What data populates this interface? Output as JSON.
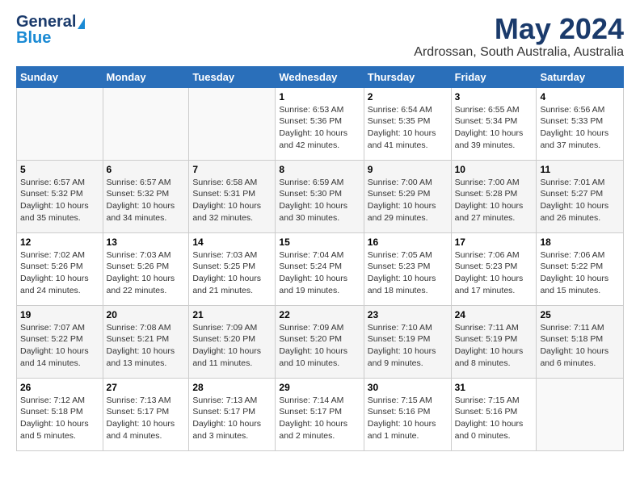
{
  "header": {
    "logo_general": "General",
    "logo_blue": "Blue",
    "month_year": "May 2024",
    "location": "Ardrossan, South Australia, Australia"
  },
  "days_of_week": [
    "Sunday",
    "Monday",
    "Tuesday",
    "Wednesday",
    "Thursday",
    "Friday",
    "Saturday"
  ],
  "weeks": [
    [
      {
        "day": "",
        "sunrise": "",
        "sunset": "",
        "daylight": ""
      },
      {
        "day": "",
        "sunrise": "",
        "sunset": "",
        "daylight": ""
      },
      {
        "day": "",
        "sunrise": "",
        "sunset": "",
        "daylight": ""
      },
      {
        "day": "1",
        "sunrise": "Sunrise: 6:53 AM",
        "sunset": "Sunset: 5:36 PM",
        "daylight": "Daylight: 10 hours and 42 minutes."
      },
      {
        "day": "2",
        "sunrise": "Sunrise: 6:54 AM",
        "sunset": "Sunset: 5:35 PM",
        "daylight": "Daylight: 10 hours and 41 minutes."
      },
      {
        "day": "3",
        "sunrise": "Sunrise: 6:55 AM",
        "sunset": "Sunset: 5:34 PM",
        "daylight": "Daylight: 10 hours and 39 minutes."
      },
      {
        "day": "4",
        "sunrise": "Sunrise: 6:56 AM",
        "sunset": "Sunset: 5:33 PM",
        "daylight": "Daylight: 10 hours and 37 minutes."
      }
    ],
    [
      {
        "day": "5",
        "sunrise": "Sunrise: 6:57 AM",
        "sunset": "Sunset: 5:32 PM",
        "daylight": "Daylight: 10 hours and 35 minutes."
      },
      {
        "day": "6",
        "sunrise": "Sunrise: 6:57 AM",
        "sunset": "Sunset: 5:32 PM",
        "daylight": "Daylight: 10 hours and 34 minutes."
      },
      {
        "day": "7",
        "sunrise": "Sunrise: 6:58 AM",
        "sunset": "Sunset: 5:31 PM",
        "daylight": "Daylight: 10 hours and 32 minutes."
      },
      {
        "day": "8",
        "sunrise": "Sunrise: 6:59 AM",
        "sunset": "Sunset: 5:30 PM",
        "daylight": "Daylight: 10 hours and 30 minutes."
      },
      {
        "day": "9",
        "sunrise": "Sunrise: 7:00 AM",
        "sunset": "Sunset: 5:29 PM",
        "daylight": "Daylight: 10 hours and 29 minutes."
      },
      {
        "day": "10",
        "sunrise": "Sunrise: 7:00 AM",
        "sunset": "Sunset: 5:28 PM",
        "daylight": "Daylight: 10 hours and 27 minutes."
      },
      {
        "day": "11",
        "sunrise": "Sunrise: 7:01 AM",
        "sunset": "Sunset: 5:27 PM",
        "daylight": "Daylight: 10 hours and 26 minutes."
      }
    ],
    [
      {
        "day": "12",
        "sunrise": "Sunrise: 7:02 AM",
        "sunset": "Sunset: 5:26 PM",
        "daylight": "Daylight: 10 hours and 24 minutes."
      },
      {
        "day": "13",
        "sunrise": "Sunrise: 7:03 AM",
        "sunset": "Sunset: 5:26 PM",
        "daylight": "Daylight: 10 hours and 22 minutes."
      },
      {
        "day": "14",
        "sunrise": "Sunrise: 7:03 AM",
        "sunset": "Sunset: 5:25 PM",
        "daylight": "Daylight: 10 hours and 21 minutes."
      },
      {
        "day": "15",
        "sunrise": "Sunrise: 7:04 AM",
        "sunset": "Sunset: 5:24 PM",
        "daylight": "Daylight: 10 hours and 19 minutes."
      },
      {
        "day": "16",
        "sunrise": "Sunrise: 7:05 AM",
        "sunset": "Sunset: 5:23 PM",
        "daylight": "Daylight: 10 hours and 18 minutes."
      },
      {
        "day": "17",
        "sunrise": "Sunrise: 7:06 AM",
        "sunset": "Sunset: 5:23 PM",
        "daylight": "Daylight: 10 hours and 17 minutes."
      },
      {
        "day": "18",
        "sunrise": "Sunrise: 7:06 AM",
        "sunset": "Sunset: 5:22 PM",
        "daylight": "Daylight: 10 hours and 15 minutes."
      }
    ],
    [
      {
        "day": "19",
        "sunrise": "Sunrise: 7:07 AM",
        "sunset": "Sunset: 5:22 PM",
        "daylight": "Daylight: 10 hours and 14 minutes."
      },
      {
        "day": "20",
        "sunrise": "Sunrise: 7:08 AM",
        "sunset": "Sunset: 5:21 PM",
        "daylight": "Daylight: 10 hours and 13 minutes."
      },
      {
        "day": "21",
        "sunrise": "Sunrise: 7:09 AM",
        "sunset": "Sunset: 5:20 PM",
        "daylight": "Daylight: 10 hours and 11 minutes."
      },
      {
        "day": "22",
        "sunrise": "Sunrise: 7:09 AM",
        "sunset": "Sunset: 5:20 PM",
        "daylight": "Daylight: 10 hours and 10 minutes."
      },
      {
        "day": "23",
        "sunrise": "Sunrise: 7:10 AM",
        "sunset": "Sunset: 5:19 PM",
        "daylight": "Daylight: 10 hours and 9 minutes."
      },
      {
        "day": "24",
        "sunrise": "Sunrise: 7:11 AM",
        "sunset": "Sunset: 5:19 PM",
        "daylight": "Daylight: 10 hours and 8 minutes."
      },
      {
        "day": "25",
        "sunrise": "Sunrise: 7:11 AM",
        "sunset": "Sunset: 5:18 PM",
        "daylight": "Daylight: 10 hours and 6 minutes."
      }
    ],
    [
      {
        "day": "26",
        "sunrise": "Sunrise: 7:12 AM",
        "sunset": "Sunset: 5:18 PM",
        "daylight": "Daylight: 10 hours and 5 minutes."
      },
      {
        "day": "27",
        "sunrise": "Sunrise: 7:13 AM",
        "sunset": "Sunset: 5:17 PM",
        "daylight": "Daylight: 10 hours and 4 minutes."
      },
      {
        "day": "28",
        "sunrise": "Sunrise: 7:13 AM",
        "sunset": "Sunset: 5:17 PM",
        "daylight": "Daylight: 10 hours and 3 minutes."
      },
      {
        "day": "29",
        "sunrise": "Sunrise: 7:14 AM",
        "sunset": "Sunset: 5:17 PM",
        "daylight": "Daylight: 10 hours and 2 minutes."
      },
      {
        "day": "30",
        "sunrise": "Sunrise: 7:15 AM",
        "sunset": "Sunset: 5:16 PM",
        "daylight": "Daylight: 10 hours and 1 minute."
      },
      {
        "day": "31",
        "sunrise": "Sunrise: 7:15 AM",
        "sunset": "Sunset: 5:16 PM",
        "daylight": "Daylight: 10 hours and 0 minutes."
      },
      {
        "day": "",
        "sunrise": "",
        "sunset": "",
        "daylight": ""
      }
    ]
  ]
}
